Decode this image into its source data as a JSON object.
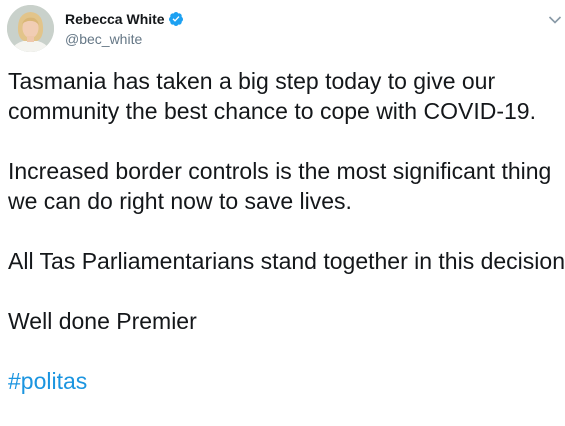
{
  "author": {
    "display_name": "Rebecca White",
    "handle": "@bec_white",
    "verified": true
  },
  "icons": {
    "verified": "verified-badge-icon",
    "menu": "chevron-down-icon"
  },
  "colors": {
    "link": "#1b95e0",
    "verified": "#1da1f2",
    "secondary_text": "#657786",
    "primary_text": "#14171a"
  },
  "tweet": {
    "lines": [
      "Tasmania has taken a big step today to give our",
      "community the best chance to cope with COVID-19.",
      "Increased border controls is the most significant thing",
      "we can do right now to save lives.",
      "All Tas Parliamentarians stand together in this decision.",
      "Well done Premier"
    ],
    "hashtag": "#politas"
  }
}
